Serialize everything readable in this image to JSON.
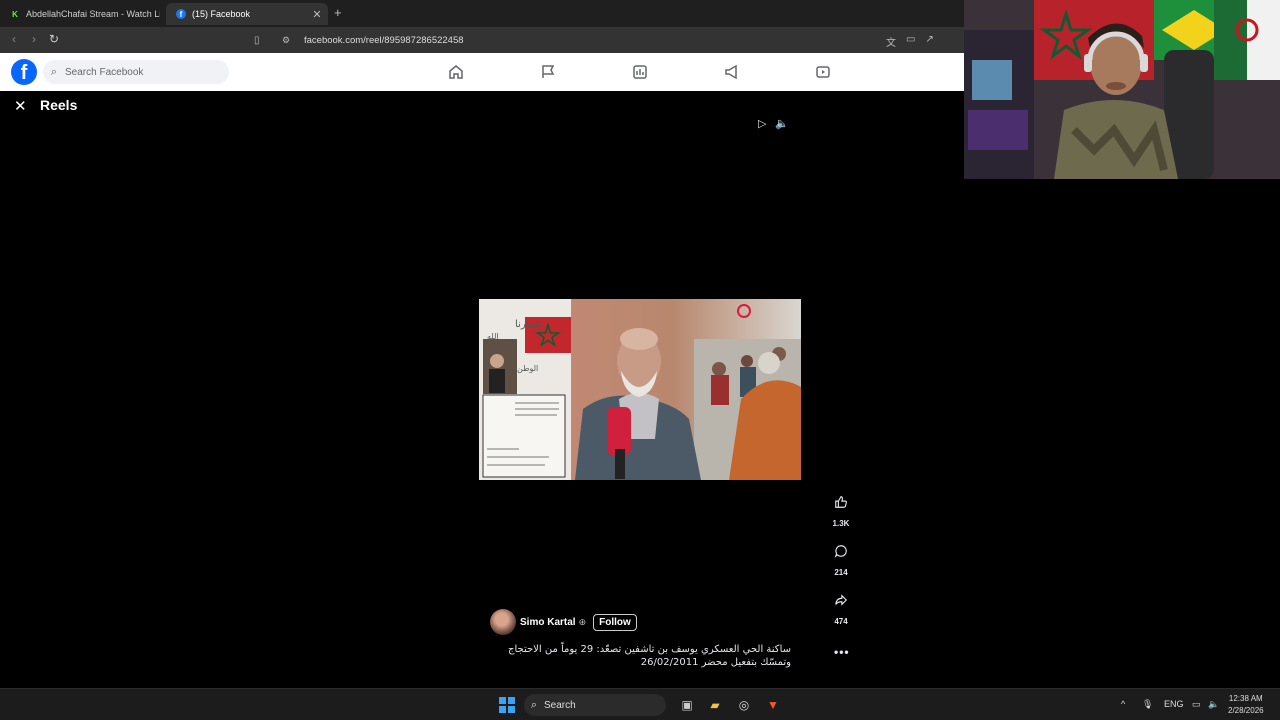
{
  "browser": {
    "tabs": [
      {
        "title": "AbdellahChafai Stream - Watch Live o",
        "icon": "kick-icon",
        "active": false
      },
      {
        "title": "(15) Facebook",
        "icon": "facebook-icon",
        "active": true
      }
    ],
    "new_tab": "+",
    "url": "facebook.com/reel/895987286522458"
  },
  "facebook": {
    "search_placeholder": "Search Facebook",
    "nav": [
      "home-icon",
      "flag-icon",
      "chart-icon",
      "megaphone-icon",
      "video-icon"
    ]
  },
  "reels": {
    "title": "Reels",
    "author": {
      "name": "Simo Kartal",
      "follow_label": "Follow"
    },
    "caption": "ساكنة الحي العسكري يوسف بن تاشفين تصعّد: 29 يوماً من الاحتجاج وتمسّك بتفعيل محضر 26/02/2011",
    "video_text": {
      "sign_line1": "شعارنا",
      "sign_line2": "الله",
      "sign_line3": "الوطن"
    },
    "actions": {
      "likes": "1.3K",
      "comments": "214",
      "shares": "474"
    }
  },
  "taskbar": {
    "search_label": "Search",
    "language": "ENG",
    "time": "12:38 AM",
    "date": "2/28/2026"
  },
  "colors": {
    "facebook_blue": "#0866ff",
    "windows_blue": "#3fa2f0"
  }
}
